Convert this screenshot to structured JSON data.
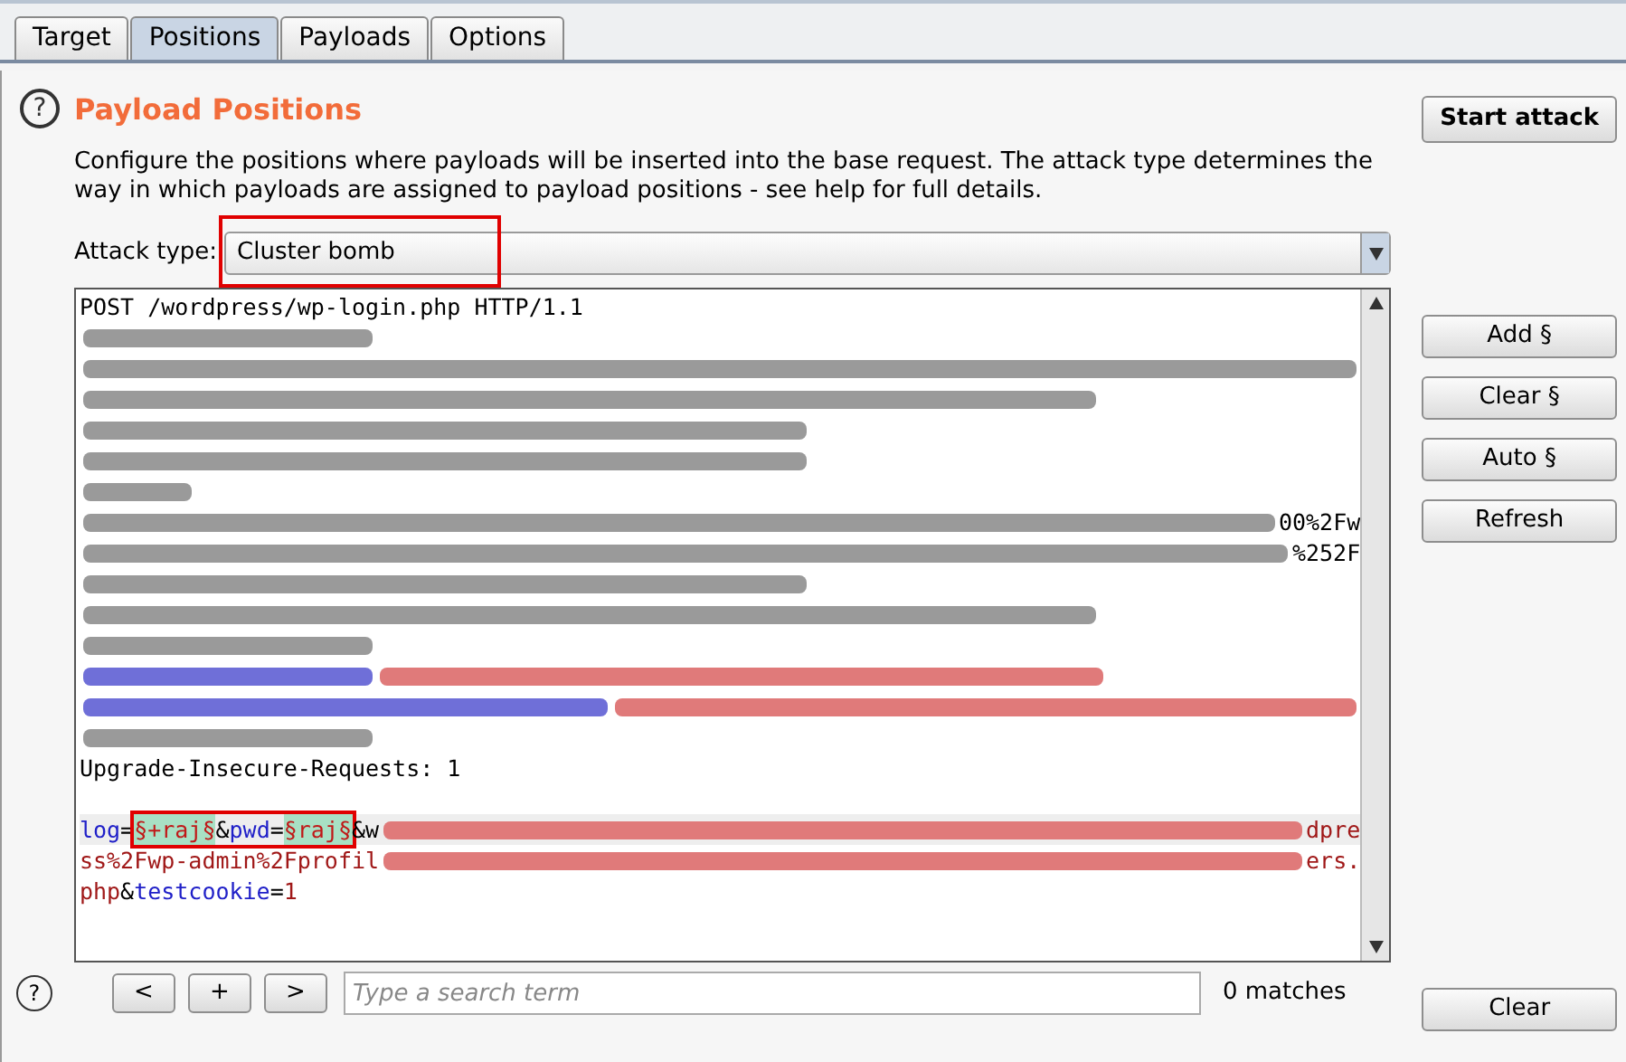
{
  "tabs": [
    {
      "label": "Target",
      "selected": false
    },
    {
      "label": "Positions",
      "selected": true
    },
    {
      "label": "Payloads",
      "selected": false
    },
    {
      "label": "Options",
      "selected": false
    }
  ],
  "header": {
    "help": "?",
    "title": "Payload Positions",
    "description": "Configure the positions where payloads will be inserted into the base request. The attack type determines the way in which payloads are assigned to payload positions - see help for full details.",
    "start_button": "Start attack"
  },
  "attack_type": {
    "label": "Attack type:",
    "value": "Cluster bomb",
    "annotated": true
  },
  "editor": {
    "lines": [
      {
        "kind": "text",
        "current": false,
        "segments": [
          {
            "kind": "plain",
            "text": "POST /wordpress/wp-login.php HTTP/1.1"
          }
        ]
      },
      {
        "kind": "text",
        "current": false,
        "segments": [
          {
            "kind": "redacted",
            "color": "#9a9a9a"
          }
        ]
      },
      {
        "kind": "text",
        "current": false,
        "segments": [
          {
            "kind": "redacted",
            "color": "#9a9a9a"
          }
        ]
      },
      {
        "kind": "text",
        "current": false,
        "segments": [
          {
            "kind": "redacted",
            "color": "#9a9a9a"
          }
        ]
      },
      {
        "kind": "text",
        "current": false,
        "segments": [
          {
            "kind": "redacted",
            "color": "#9a9a9a"
          }
        ]
      },
      {
        "kind": "text",
        "current": false,
        "segments": [
          {
            "kind": "redacted",
            "color": "#9a9a9a"
          }
        ]
      },
      {
        "kind": "text",
        "current": false,
        "segments": [
          {
            "kind": "redacted",
            "color": "#9a9a9a"
          }
        ]
      },
      {
        "kind": "text",
        "current": false,
        "segments": [
          {
            "kind": "redacted",
            "color": "#9a9a9a"
          },
          {
            "kind": "plain",
            "text": "00%2Fw"
          }
        ]
      },
      {
        "kind": "text",
        "current": false,
        "segments": [
          {
            "kind": "redacted",
            "color": "#9a9a9a"
          },
          {
            "kind": "plain",
            "text": "%252F"
          }
        ]
      },
      {
        "kind": "text",
        "current": false,
        "segments": [
          {
            "kind": "redacted",
            "color": "#9a9a9a"
          }
        ]
      },
      {
        "kind": "text",
        "current": false,
        "segments": [
          {
            "kind": "redacted",
            "color": "#9a9a9a"
          }
        ]
      },
      {
        "kind": "text",
        "current": false,
        "segments": [
          {
            "kind": "redacted",
            "color": "#9a9a9a"
          }
        ]
      },
      {
        "kind": "text",
        "current": false,
        "segments": [
          {
            "kind": "redacted",
            "color": "#6f6fd8"
          },
          {
            "kind": "redacted",
            "color": "#e07a7a"
          }
        ]
      },
      {
        "kind": "text",
        "current": false,
        "segments": [
          {
            "kind": "redacted",
            "color": "#6f6fd8"
          },
          {
            "kind": "redacted",
            "color": "#e07a7a"
          }
        ]
      },
      {
        "kind": "text",
        "current": false,
        "segments": [
          {
            "kind": "redacted",
            "color": "#9a9a9a"
          }
        ]
      },
      {
        "kind": "text",
        "current": false,
        "segments": [
          {
            "kind": "plain",
            "text": "Upgrade-Insecure-Requests: 1"
          }
        ]
      },
      {
        "kind": "blank",
        "current": false
      },
      {
        "kind": "text",
        "current": true,
        "segments": [
          {
            "kind": "param",
            "text": "log"
          },
          {
            "kind": "plain",
            "text": "="
          },
          {
            "kind": "group",
            "annotated": true,
            "segments": [
              {
                "kind": "marker",
                "text": "§+raj§"
              },
              {
                "kind": "plain",
                "text": "&"
              },
              {
                "kind": "param",
                "text": "pwd"
              },
              {
                "kind": "plain",
                "text": "="
              },
              {
                "kind": "marker",
                "text": "§raj§"
              }
            ]
          },
          {
            "kind": "plain",
            "text": "&w"
          },
          {
            "kind": "redacted",
            "color": "#e07a7a"
          },
          {
            "kind": "value",
            "text": "dpre"
          }
        ]
      },
      {
        "kind": "text",
        "current": false,
        "segments": [
          {
            "kind": "value",
            "text": "ss%2Fwp-admin%2Fprofil"
          },
          {
            "kind": "redacted",
            "color": "#e07a7a"
          },
          {
            "kind": "value",
            "text": "ers."
          }
        ]
      },
      {
        "kind": "text",
        "current": false,
        "segments": [
          {
            "kind": "value",
            "text": "php"
          },
          {
            "kind": "plain",
            "text": "&"
          },
          {
            "kind": "param",
            "text": "testcookie"
          },
          {
            "kind": "plain",
            "text": "="
          },
          {
            "kind": "value",
            "text": "1"
          }
        ]
      }
    ]
  },
  "side_buttons": [
    "Add §",
    "Clear §",
    "Auto §",
    "Refresh"
  ],
  "search": {
    "help": "?",
    "prev": "<",
    "add": "+",
    "next": ">",
    "placeholder": "Type a search term",
    "matches": "0 matches",
    "clear": "Clear"
  }
}
